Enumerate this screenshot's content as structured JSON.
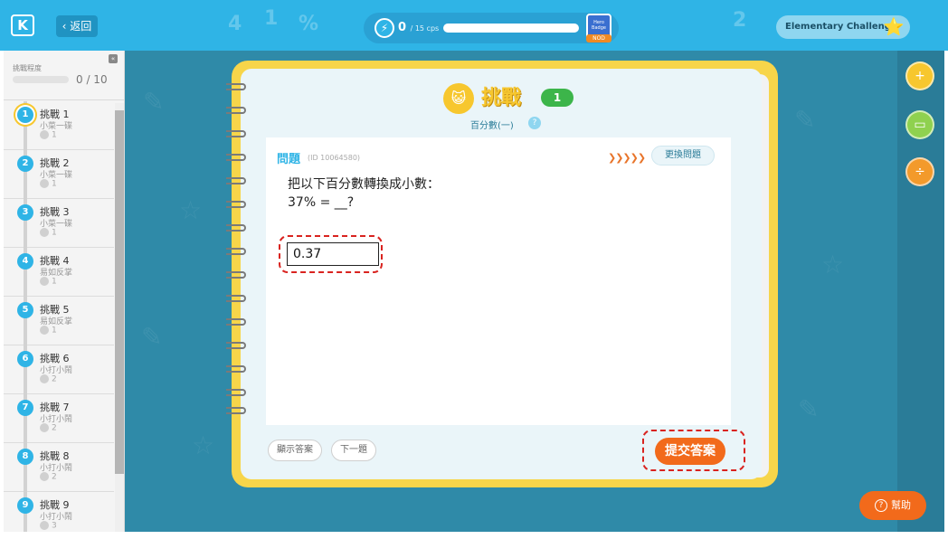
{
  "header": {
    "logo_text": "K",
    "back_label": "返回",
    "deco": [
      "4",
      "1",
      "%",
      "2"
    ],
    "score_value": "0",
    "score_unit": "/ 15 cps",
    "badge_text": "Hero Badge",
    "badge_sub": "NOD",
    "challenge_label": "Elementary Challenge",
    "star": "⭐"
  },
  "sidebar": {
    "progress_label": "挑戰程度",
    "progress_count": "0 / 10",
    "collapse": "«",
    "items": [
      {
        "num": "1",
        "title": "挑戰 1",
        "sub": "小菜一碟",
        "pts": "1"
      },
      {
        "num": "2",
        "title": "挑戰 2",
        "sub": "小菜一碟",
        "pts": "1"
      },
      {
        "num": "3",
        "title": "挑戰 3",
        "sub": "小菜一碟",
        "pts": "1"
      },
      {
        "num": "4",
        "title": "挑戰 4",
        "sub": "易如反掌",
        "pts": "1"
      },
      {
        "num": "5",
        "title": "挑戰 5",
        "sub": "易如反掌",
        "pts": "1"
      },
      {
        "num": "6",
        "title": "挑戰 6",
        "sub": "小打小鬧",
        "pts": "2"
      },
      {
        "num": "7",
        "title": "挑戰 7",
        "sub": "小打小鬧",
        "pts": "2"
      },
      {
        "num": "8",
        "title": "挑戰 8",
        "sub": "小打小鬧",
        "pts": "2"
      },
      {
        "num": "9",
        "title": "挑戰 9",
        "sub": "小打小鬧",
        "pts": "3"
      }
    ]
  },
  "challenge": {
    "title": "挑戰",
    "level": "1",
    "topic": "百分數(一)",
    "help": "?"
  },
  "question": {
    "label": "問題",
    "id": "(ID 10064580)",
    "hint_marks": "❯❯❯❯❯",
    "change_label": "更換問題",
    "text": "把以下百分數轉換成小數：",
    "equation": "37% = __?",
    "answer_value": "0.37"
  },
  "actions": {
    "show_answer": "顯示答案",
    "next": "下一題",
    "submit": "提交答案"
  },
  "help_button": {
    "label": "幫助",
    "icon": "?"
  },
  "tools": [
    "+",
    "▭",
    "÷"
  ],
  "colors": {
    "topbar": "#2fb4e6",
    "board": "#2f8aa8",
    "notebook": "#f7d54a",
    "submit": "#f26a1b",
    "highlight": "#d9231f",
    "level_badge": "#3cb54a"
  }
}
